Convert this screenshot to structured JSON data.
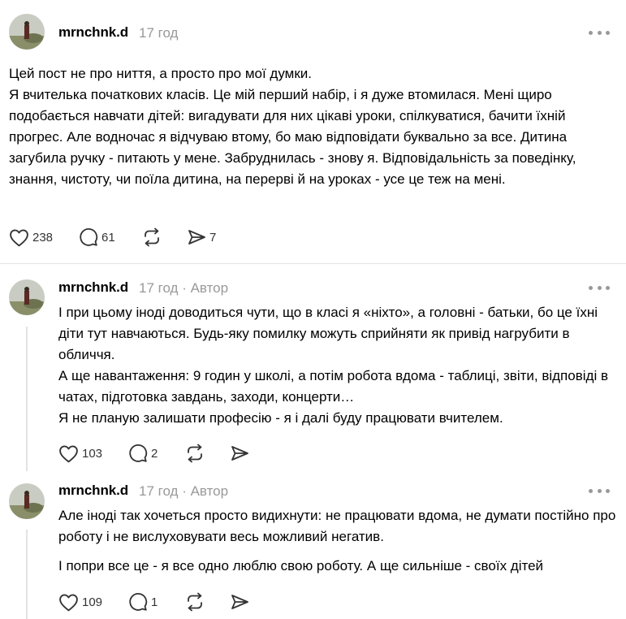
{
  "posts": [
    {
      "username": "mrnchnk.d",
      "time": "17 год",
      "author_label": "",
      "paragraphs": [
        "Цей пост не про ниття, а просто про мої думки.",
        "Я вчителька початкових класів. Це мій перший набір, і я дуже втомилася. Мені щиро подобається навчати дітей: вигадувати для них цікаві уроки, спілкуватися, бачити їхній прогрес. Але водночас я відчуваю втому, бо маю відповідати буквально за все. Дитина загубила ручку - питають у мене. Забруднилась - знову я. Відповідальність за поведінку, знання, чистоту, чи поїла дитина, на перерві й на уроках - усе це теж на мені."
      ],
      "likes": "238",
      "replies": "61",
      "reposts": "",
      "shares": "7"
    },
    {
      "username": "mrnchnk.d",
      "time": "17 год",
      "author_label": "· Автор",
      "paragraphs": [
        "І при цьому іноді доводиться чути, що в класі я «ніхто», а головні - батьки, бо це їхні діти тут навчаються. Будь-яку помилку можуть сприйняти як привід нагрубити в обличчя.",
        "А ще навантаження: 9 годин у школі, а потім робота вдома - таблиці, звіти, відповіді в чатах, підготовка завдань, заходи, концерти…",
        "Я не планую залишати професію - я і далі буду працювати вчителем."
      ],
      "likes": "103",
      "replies": "2",
      "reposts": "",
      "shares": ""
    },
    {
      "username": "mrnchnk.d",
      "time": "17 год",
      "author_label": "· Автор",
      "paragraphs": [
        "Але іноді так хочеться просто видихнути: не працювати вдома, не думати постійно про роботу і не вислуховувати весь можливий негатив.",
        "І попри все це - я все одно люблю свою роботу. А ще сильніше - своїх дітей"
      ],
      "likes": "109",
      "replies": "1",
      "reposts": "",
      "shares": ""
    }
  ],
  "icons": {
    "like": "heart-icon",
    "reply": "comment-icon",
    "repost": "repost-icon",
    "share": "share-icon",
    "more": "more-icon"
  },
  "colors": {
    "muted": "#999999",
    "divider": "#e3e3e3",
    "text": "#000000"
  }
}
